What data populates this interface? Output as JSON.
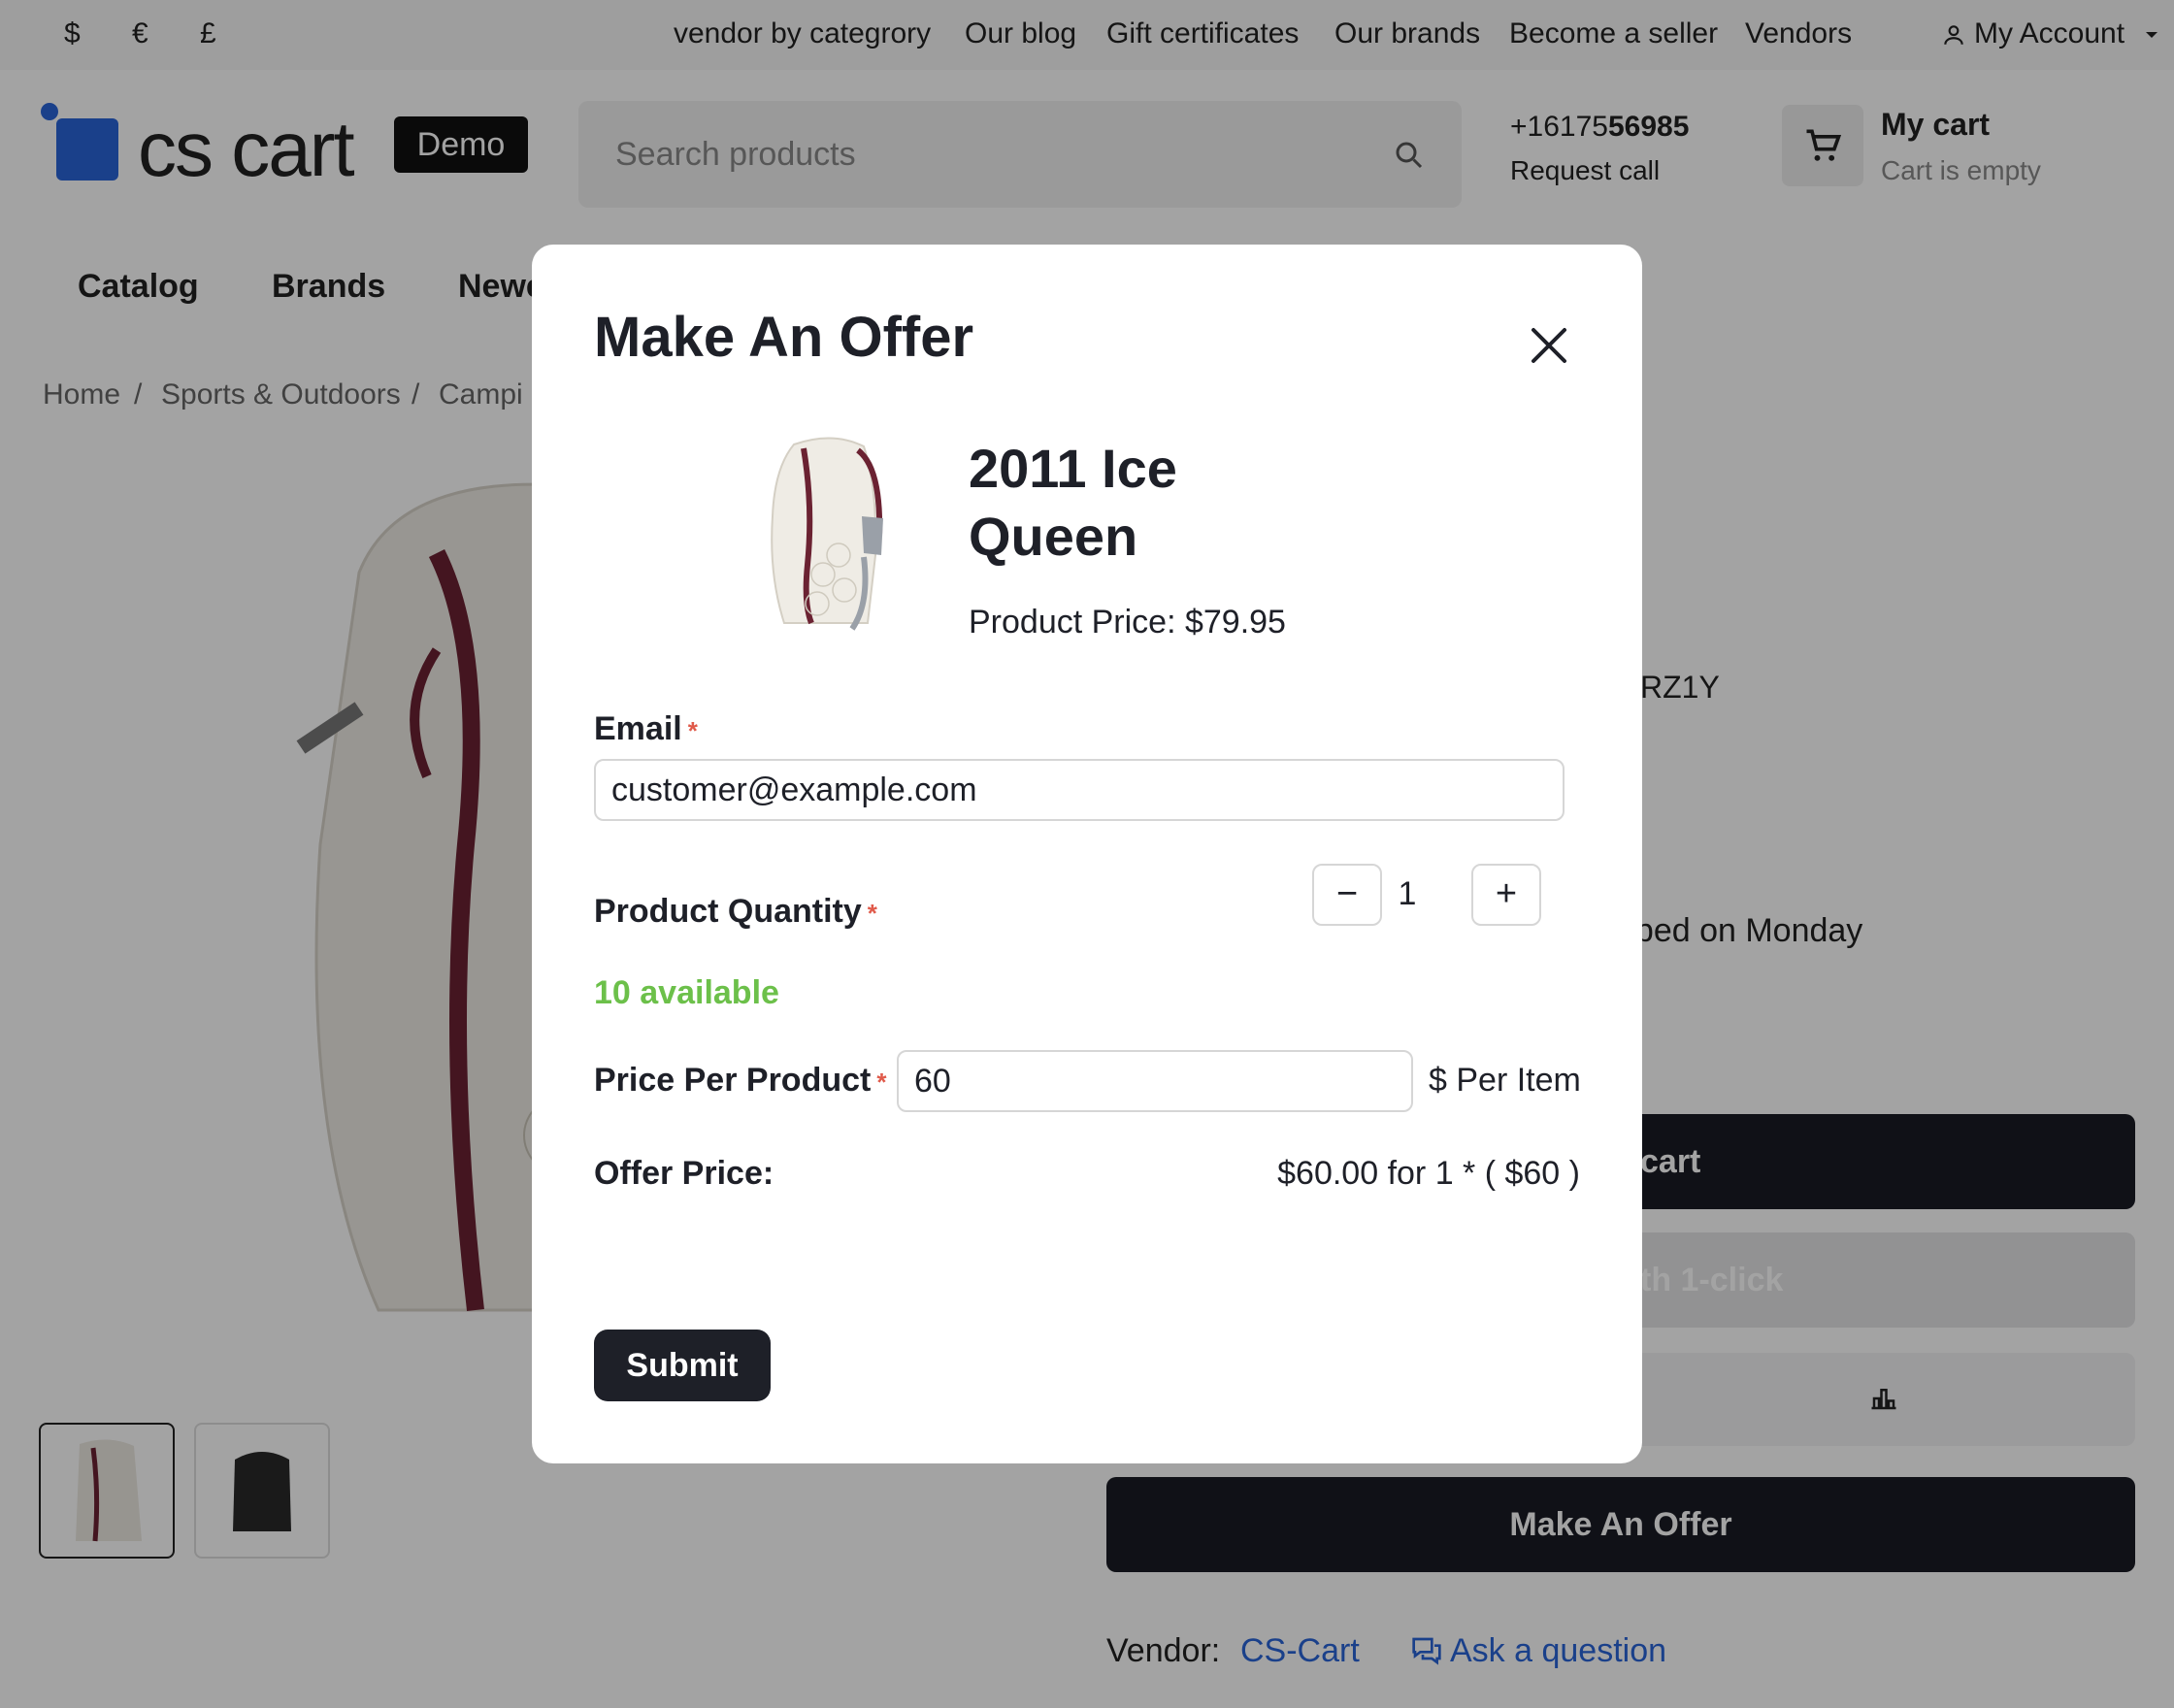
{
  "topbar": {
    "currencies": [
      "$",
      "€",
      "£"
    ],
    "links": [
      "vendor by categrory",
      "Our blog",
      "Gift certificates",
      "Our brands",
      "Become a seller",
      "Vendors"
    ],
    "account": "My Account"
  },
  "header": {
    "logo_text": "cs cart",
    "logo_badge": "Demo",
    "search_placeholder": "Search products",
    "phone_prefix": "+16175",
    "phone_bold": "56985",
    "request_call": "Request call",
    "cart_title": "My cart",
    "cart_status": "Cart is empty"
  },
  "nav": [
    "Catalog",
    "Brands",
    "Newe"
  ],
  "breadcrumb": [
    "Home",
    "/",
    "Sports & Outdoors",
    "/",
    "Campi"
  ],
  "background_product": {
    "sku_fragment": "RZ1Y",
    "shipping_fragment": "pped on Monday",
    "add_to_cart_fragment": "cart",
    "one_click_fragment": "th 1-click",
    "make_offer": "Make An Offer",
    "vendor_label": "Vendor:",
    "vendor_name": "CS-Cart",
    "ask_question": "Ask a question"
  },
  "modal": {
    "title": "Make An Offer",
    "product_name": "2011 Ice Queen",
    "product_price": "Product Price: $79.95",
    "email_label": "Email",
    "email_value": "customer@example.com",
    "quantity_label": "Product Quantity",
    "quantity_value": "1",
    "available": "10 available",
    "price_label": "Price Per Product",
    "price_value": "60",
    "price_unit": "$ Per Item",
    "offer_label": "Offer Price:",
    "offer_value": "$60.00 for 1 * ( $60 )",
    "submit_label": "Submit",
    "required_mark": "*"
  },
  "colors": {
    "accent_dark": "#1e2028",
    "available_green": "#6cc04a",
    "required_red": "#e05a4a",
    "link_blue": "#2a64d8"
  }
}
